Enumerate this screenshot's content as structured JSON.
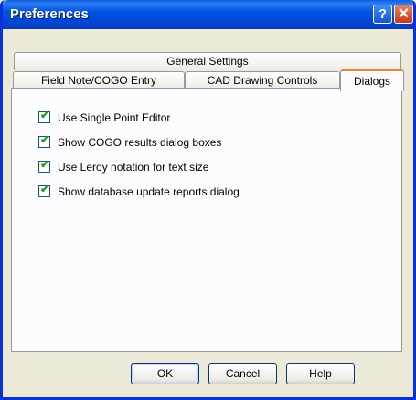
{
  "window": {
    "title": "Preferences",
    "help_glyph": "?",
    "close_glyph": "✕"
  },
  "tabs": {
    "general": "General Settings",
    "field_note": "Field Note/COGO Entry",
    "cad": "CAD Drawing Controls",
    "dialogs": "Dialogs"
  },
  "options": [
    {
      "label": "Use Single Point Editor",
      "checked": true
    },
    {
      "label": "Show COGO results dialog boxes",
      "checked": true
    },
    {
      "label": "Use Leroy notation for text size",
      "checked": true
    },
    {
      "label": "Show database update reports dialog",
      "checked": true
    }
  ],
  "check_glyph": "✔",
  "buttons": {
    "ok": "OK",
    "cancel": "Cancel",
    "help": "Help"
  }
}
